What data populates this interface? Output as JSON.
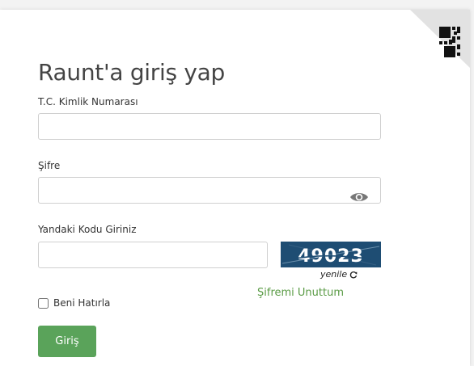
{
  "login": {
    "title": "Raunt'a giriş yap",
    "tc_label": "T.C. Kimlik Numarası",
    "tc_value": "",
    "password_label": "Şifre",
    "password_value": "",
    "captcha_label": "Yandaki Kodu Giriniz",
    "captcha_value": "",
    "captcha_code": "49023",
    "refresh_label": "yenile",
    "remember_label": "Beni Hatırla",
    "remember_checked": false,
    "forgot_label": "Şifremi Unuttum",
    "submit_label": "Giriş"
  },
  "icons": {
    "qr": "qr-code-icon",
    "eye": "eye-icon",
    "refresh": "refresh-icon"
  },
  "colors": {
    "accent_green": "#5aa35a",
    "link_green": "#5a9b45",
    "captcha_bg": "#1e4d73",
    "captcha_text": "#ffffff"
  }
}
